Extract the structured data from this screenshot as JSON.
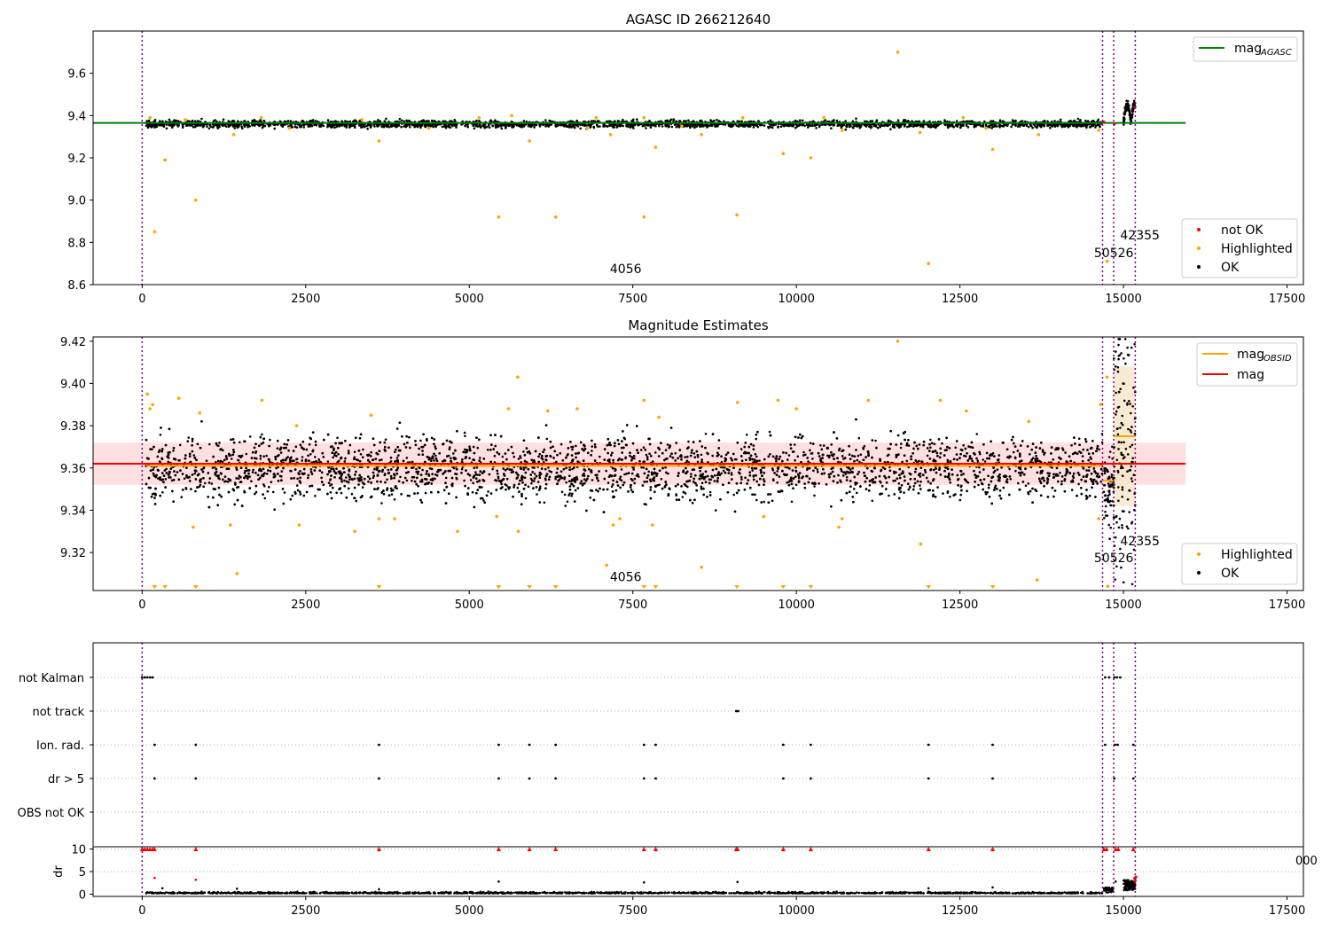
{
  "colors": {
    "ok": "#000000",
    "highlighted": "#ffa500",
    "not_ok": "#ff0000",
    "agasc": "#008000",
    "mag_obsid": "#ffa500",
    "mag": "#ff0000",
    "band": "#ffcccc",
    "vline": "#800080",
    "grid": "#b0b0b0"
  },
  "chart_data": [
    {
      "type": "scatter",
      "title": "AGASC ID 266212640",
      "xlim": [
        -750,
        17750
      ],
      "ylim": [
        8.6,
        9.8
      ],
      "xticks": [
        0,
        2500,
        5000,
        7500,
        10000,
        12500,
        15000,
        17500
      ],
      "xtick_labels": [
        "0",
        "2500",
        "5000",
        "7500",
        "10000",
        "12500",
        "15000",
        "17500"
      ],
      "yticks": [
        8.6,
        8.8,
        9.0,
        9.2,
        9.4,
        9.6
      ],
      "ytick_labels": [
        "8.6",
        "8.8",
        "9.0",
        "9.2",
        "9.4",
        "9.6"
      ],
      "line_legend": {
        "placement": "upper right",
        "entries": [
          {
            "label": "mag",
            "sub": "AGASC"
          }
        ]
      },
      "point_legend": {
        "placement": "lower right",
        "entries": [
          "not OK",
          "Highlighted",
          "OK"
        ]
      },
      "agasc_mag": 9.365,
      "agasc_line_x": [
        -750,
        15950
      ],
      "ok_band": {
        "center": 9.36,
        "spread": 0.012
      },
      "late_segment": {
        "x": [
          15000,
          15180
        ],
        "low": 9.33,
        "high": 9.45
      },
      "vlines": [
        0,
        14680,
        14850,
        15180
      ],
      "obsid_labels": [
        {
          "text": "4056",
          "x": 7150,
          "y": 8.655
        },
        {
          "text": "50526",
          "x": 14550,
          "y": 8.73
        },
        {
          "text": "42355",
          "x": 14950,
          "y": 8.815
        }
      ],
      "highlighted_points": [
        [
          190,
          8.85
        ],
        [
          350,
          9.19
        ],
        [
          820,
          9.0
        ],
        [
          1400,
          9.31
        ],
        [
          3620,
          9.28
        ],
        [
          5450,
          8.92
        ],
        [
          5920,
          9.28
        ],
        [
          6320,
          8.92
        ],
        [
          7160,
          9.31
        ],
        [
          7670,
          8.92
        ],
        [
          7850,
          9.25
        ],
        [
          8550,
          9.31
        ],
        [
          9090,
          8.93
        ],
        [
          9800,
          9.22
        ],
        [
          10220,
          9.2
        ],
        [
          11550,
          9.7
        ],
        [
          11890,
          9.32
        ],
        [
          12020,
          8.7
        ],
        [
          13000,
          9.24
        ],
        [
          13700,
          9.31
        ],
        [
          14750,
          8.71
        ],
        [
          120,
          9.39
        ],
        [
          660,
          9.38
        ],
        [
          1820,
          9.39
        ],
        [
          3360,
          9.38
        ],
        [
          5150,
          9.39
        ],
        [
          5650,
          9.4
        ],
        [
          6940,
          9.39
        ],
        [
          7670,
          9.39
        ],
        [
          9180,
          9.39
        ],
        [
          10420,
          9.39
        ],
        [
          12550,
          9.39
        ],
        [
          14620,
          9.33
        ],
        [
          2250,
          9.34
        ],
        [
          4380,
          9.34
        ],
        [
          6800,
          9.34
        ],
        [
          8250,
          9.35
        ],
        [
          10700,
          9.33
        ],
        [
          12900,
          9.34
        ]
      ],
      "not_ok_points": [
        [
          14700,
          9.37
        ],
        [
          14860,
          9.36
        ],
        [
          15170,
          9.44
        ]
      ]
    },
    {
      "type": "scatter",
      "title": "Magnitude Estimates",
      "xlim": [
        -750,
        17750
      ],
      "ylim": [
        9.302,
        9.422
      ],
      "xticks": [
        0,
        2500,
        5000,
        7500,
        10000,
        12500,
        15000,
        17500
      ],
      "xtick_labels": [
        "0",
        "2500",
        "5000",
        "7500",
        "10000",
        "12500",
        "15000",
        "17500"
      ],
      "yticks": [
        9.32,
        9.34,
        9.36,
        9.38,
        9.4,
        9.42
      ],
      "ytick_labels": [
        "9.32",
        "9.34",
        "9.36",
        "9.38",
        "9.40",
        "9.42"
      ],
      "line_legend": {
        "placement": "upper right",
        "entries": [
          {
            "label": "mag",
            "sub": "OBSID"
          },
          {
            "label": "mag",
            "sub": ""
          }
        ]
      },
      "point_legend": {
        "placement": "lower right",
        "entries": [
          "Highlighted",
          "OK"
        ]
      },
      "mag": 9.362,
      "mag_band": [
        9.352,
        9.372
      ],
      "mag_line_x": [
        -750,
        15950
      ],
      "mag_obsid": [
        {
          "x": [
            60,
            14680
          ],
          "y": 9.361
        },
        {
          "x": [
            14680,
            14850
          ],
          "y": 9.354
        },
        {
          "x": [
            14850,
            15180
          ],
          "y": 9.375
        }
      ],
      "obsid_band": {
        "x": [
          14850,
          15180
        ],
        "y": [
          9.342,
          9.408
        ]
      },
      "ok_band": {
        "center": 9.36,
        "spread": 0.0075
      },
      "vlines": [
        0,
        14680,
        14850,
        15180
      ],
      "obsid_labels": [
        {
          "text": "4056",
          "x": 7150,
          "y": 9.3065
        },
        {
          "text": "50526",
          "x": 14550,
          "y": 9.3155
        },
        {
          "text": "42355",
          "x": 14950,
          "y": 9.3235
        }
      ],
      "highlighted_points": [
        [
          80,
          9.395
        ],
        [
          120,
          9.388
        ],
        [
          160,
          9.39
        ],
        [
          560,
          9.393
        ],
        [
          780,
          9.332
        ],
        [
          880,
          9.386
        ],
        [
          1350,
          9.333
        ],
        [
          1450,
          9.31
        ],
        [
          1830,
          9.392
        ],
        [
          2360,
          9.38
        ],
        [
          2400,
          9.333
        ],
        [
          3250,
          9.33
        ],
        [
          3500,
          9.385
        ],
        [
          3620,
          9.336
        ],
        [
          3860,
          9.336
        ],
        [
          4820,
          9.33
        ],
        [
          5420,
          9.337
        ],
        [
          5600,
          9.388
        ],
        [
          5750,
          9.33
        ],
        [
          5740,
          9.403
        ],
        [
          6200,
          9.387
        ],
        [
          6650,
          9.388
        ],
        [
          7100,
          9.314
        ],
        [
          7200,
          9.333
        ],
        [
          7300,
          9.336
        ],
        [
          7670,
          9.392
        ],
        [
          7800,
          9.333
        ],
        [
          7900,
          9.384
        ],
        [
          8550,
          9.313
        ],
        [
          9100,
          9.391
        ],
        [
          9500,
          9.337
        ],
        [
          9720,
          9.392
        ],
        [
          10000,
          9.388
        ],
        [
          10650,
          9.332
        ],
        [
          10700,
          9.336
        ],
        [
          11100,
          9.392
        ],
        [
          11550,
          9.42
        ],
        [
          11900,
          9.324
        ],
        [
          12200,
          9.392
        ],
        [
          12600,
          9.387
        ],
        [
          13550,
          9.382
        ],
        [
          13680,
          9.307
        ],
        [
          14650,
          9.39
        ],
        [
          14620,
          9.336
        ],
        [
          14750,
          9.403
        ],
        [
          14760,
          9.304
        ]
      ],
      "edge_markers_x": [
        190,
        350,
        820,
        3620,
        5450,
        5920,
        6320,
        7670,
        7850,
        9090,
        9800,
        10220,
        12020,
        13000
      ]
    },
    {
      "type": "scatter",
      "title": "",
      "xlim": [
        -750,
        17750
      ],
      "xticks": [
        0,
        2500,
        5000,
        7500,
        10000,
        12500,
        15000,
        17500
      ],
      "xtick_labels": [
        "0",
        "2500",
        "5000",
        "7500",
        "10000",
        "12500",
        "15000",
        "17500"
      ],
      "categories": [
        "not Kalman",
        "not track",
        "Ion. rad.",
        "dr > 5",
        "OBS not OK"
      ],
      "flag_points": {
        "not Kalman": [
          0,
          40,
          80,
          120,
          160,
          14720,
          14780,
          14860,
          14900,
          14950
        ],
        "not track": [
          9080,
          9110
        ],
        "Ion. rad.": [
          190,
          820,
          3620,
          5450,
          5920,
          6320,
          7670,
          7850,
          9800,
          10220,
          12020,
          13000,
          14720,
          14870,
          14910,
          15150
        ],
        "dr > 5": [
          190,
          820,
          3620,
          5450,
          5920,
          6320,
          7670,
          7850,
          9800,
          10220,
          12020,
          13000,
          14860,
          15150
        ],
        "OBS not OK": []
      },
      "vlines": [
        0,
        14680,
        14850,
        15180
      ]
    },
    {
      "type": "scatter",
      "title": "",
      "ylabel": "dr",
      "xlim": [
        -750,
        17750
      ],
      "ylim": [
        -0.5,
        10.5
      ],
      "yticks": [
        0,
        5,
        10
      ],
      "ytick_labels": [
        "0",
        "5",
        "10"
      ],
      "xticks": [
        0,
        2500,
        5000,
        7500,
        10000,
        12500,
        15000,
        17500
      ],
      "xtick_labels": [
        "0",
        "2500",
        "5000",
        "7500",
        "10000",
        "12500",
        "15000",
        "17500"
      ],
      "stray_label": "000",
      "capped_points_x": [
        0,
        40,
        80,
        120,
        160,
        190,
        820,
        3620,
        5450,
        5920,
        6320,
        7670,
        7850,
        9080,
        9100,
        9800,
        10220,
        12020,
        13000,
        14700,
        14740,
        14880,
        14920,
        15150
      ],
      "mid_points": [
        [
          190,
          3.6
        ],
        [
          820,
          3.2
        ],
        [
          9100,
          2.7
        ],
        [
          5450,
          2.8
        ],
        [
          7670,
          2.6
        ],
        [
          310,
          1.3
        ],
        [
          1450,
          1.2
        ],
        [
          3620,
          1.1
        ],
        [
          12020,
          1.3
        ],
        [
          13000,
          1.5
        ],
        [
          14880,
          2.8
        ]
      ],
      "red_points": [
        [
          15170,
          3.5
        ],
        [
          15180,
          3.0
        ],
        [
          15190,
          3.8
        ]
      ],
      "late_cluster": {
        "x": [
          15000,
          15180
        ],
        "low": 0.8,
        "high": 3.2
      },
      "vlines": [
        0,
        14680,
        14850,
        15180
      ]
    }
  ]
}
